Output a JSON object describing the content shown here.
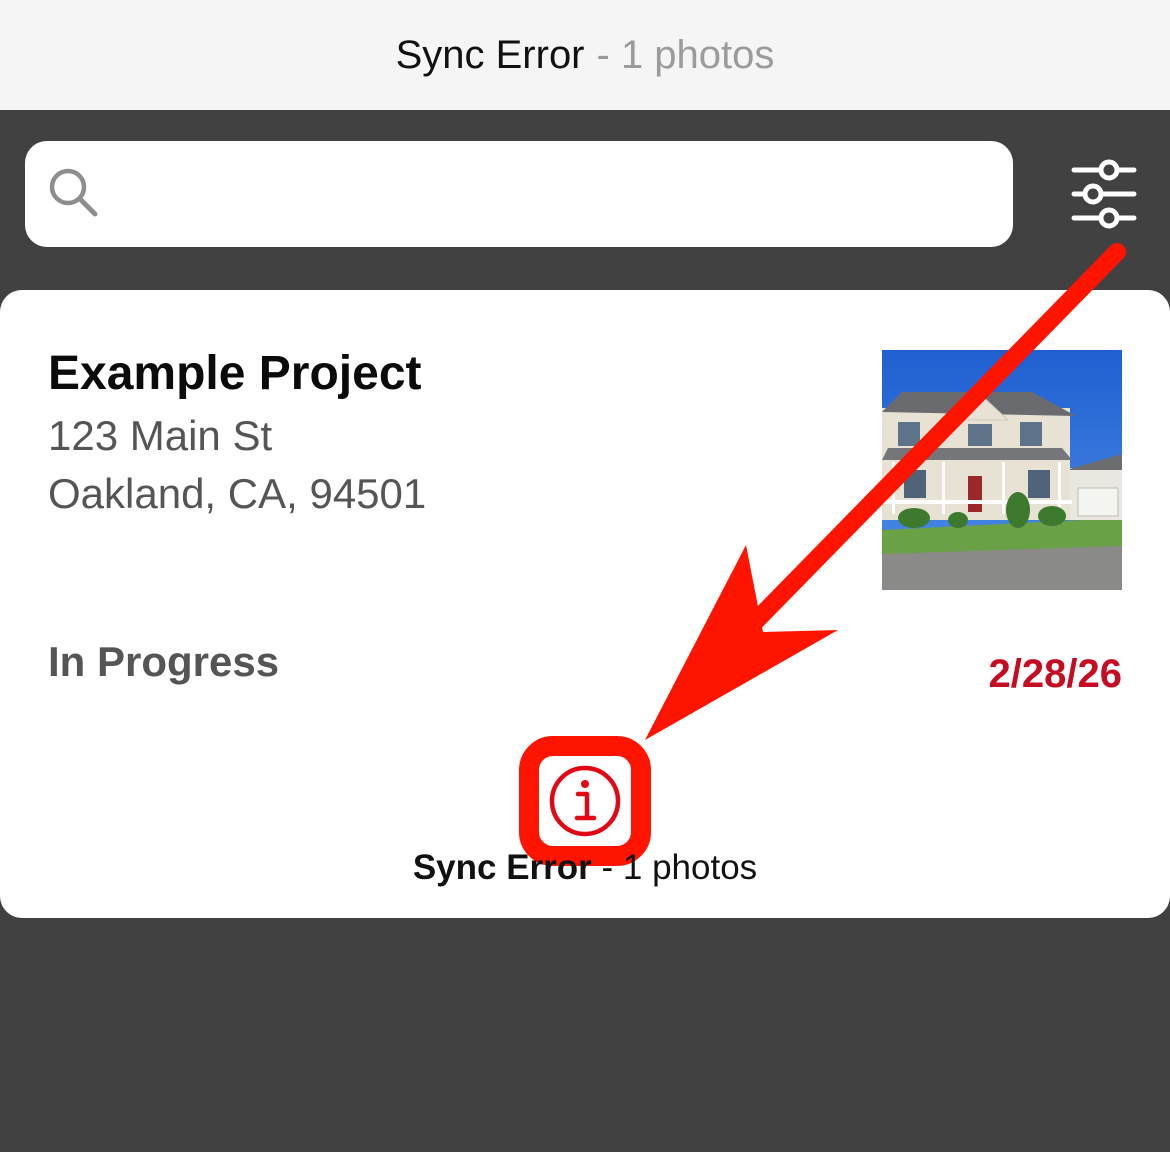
{
  "top_status": {
    "label": "Sync Error",
    "count": "- 1 photos"
  },
  "search": {
    "placeholder": "",
    "value": ""
  },
  "icons": {
    "search": "search-icon",
    "filter": "sliders-filter-icon",
    "info": "info-icon",
    "arrow": "annotation-arrow"
  },
  "project": {
    "title": "Example Project",
    "address_line1": "123 Main St",
    "address_line2": "Oakland, CA, 94501",
    "status": "In Progress",
    "date": "2/28/26",
    "sync_status_label": "Sync Error",
    "sync_status_count": "- 1 photos"
  },
  "colors": {
    "accent_red": "#c60c23",
    "annotation_red": "#ff1400",
    "toolbar_bg": "#414141",
    "status_bar_bg": "#f5f5f5"
  }
}
